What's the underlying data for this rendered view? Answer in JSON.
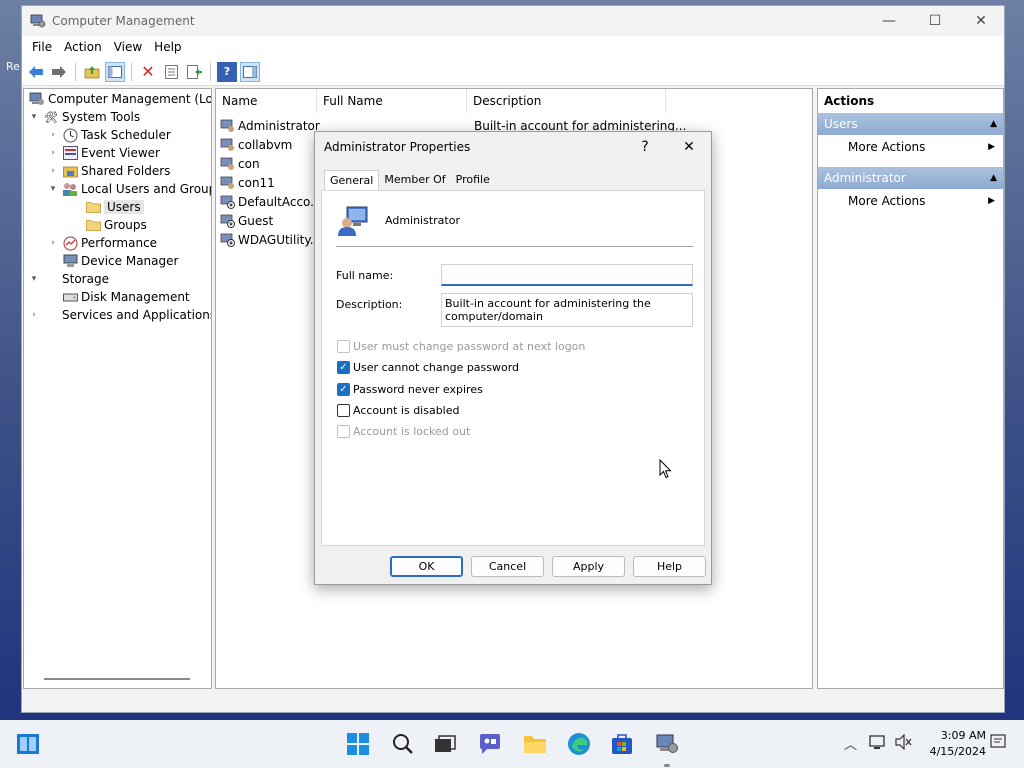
{
  "window": {
    "title": "Computer Management",
    "minimize_glyph": "—",
    "maximize_glyph": "☐",
    "close_glyph": "✕"
  },
  "menu": [
    "File",
    "Action",
    "View",
    "Help"
  ],
  "toolbar": {
    "icons": [
      "back-arrow-icon",
      "forward-arrow-icon",
      "up-folder-icon",
      "show-hide-tree-icon",
      "delete-icon",
      "properties-icon",
      "export-list-icon",
      "help-icon",
      "show-hide-action-pane-icon"
    ]
  },
  "tree": {
    "items": [
      {
        "label": "Computer Management (Local",
        "level": 0,
        "arrow": "",
        "icon": "computer-management-icon"
      },
      {
        "label": "System Tools",
        "level": 1,
        "arrow": "▾",
        "icon": "system-tools-icon"
      },
      {
        "label": "Task Scheduler",
        "level": 2,
        "arrow": "›",
        "icon": "task-scheduler-icon"
      },
      {
        "label": "Event Viewer",
        "level": 2,
        "arrow": "›",
        "icon": "event-viewer-icon"
      },
      {
        "label": "Shared Folders",
        "level": 2,
        "arrow": "›",
        "icon": "shared-folders-icon"
      },
      {
        "label": "Local Users and Groups",
        "level": 2,
        "arrow": "▾",
        "icon": "local-users-groups-icon"
      },
      {
        "label": "Users",
        "level": 3,
        "arrow": "",
        "icon": "folder-icon",
        "selected": true
      },
      {
        "label": "Groups",
        "level": 3,
        "arrow": "",
        "icon": "folder-icon"
      },
      {
        "label": "Performance",
        "level": 2,
        "arrow": "›",
        "icon": "performance-icon"
      },
      {
        "label": "Device Manager",
        "level": 2,
        "arrow": "",
        "icon": "device-manager-icon"
      },
      {
        "label": "Storage",
        "level": 1,
        "arrow": "▾",
        "icon": "storage-icon"
      },
      {
        "label": "Disk Management",
        "level": 2,
        "arrow": "",
        "icon": "disk-management-icon"
      },
      {
        "label": "Services and Applications",
        "level": 1,
        "arrow": "›",
        "icon": "services-applications-icon"
      }
    ]
  },
  "list": {
    "columns": [
      "Name",
      "Full Name",
      "Description"
    ],
    "rows": [
      {
        "name": "Administrator",
        "description": "Built-in account for administering..."
      },
      {
        "name": "collabvm",
        "description": ""
      },
      {
        "name": "con",
        "description": ""
      },
      {
        "name": "con11",
        "description": ""
      },
      {
        "name": "DefaultAcco...",
        "description": ""
      },
      {
        "name": "Guest",
        "description": ""
      },
      {
        "name": "WDAGUtility...",
        "description": ""
      }
    ]
  },
  "actions": {
    "title": "Actions",
    "sections": [
      {
        "header": "Users",
        "item": "More Actions"
      },
      {
        "header": "Administrator",
        "item": "More Actions"
      }
    ],
    "collapse_glyph": "▲",
    "submenu_glyph": "▶"
  },
  "dialog": {
    "title": "Administrator Properties",
    "help_glyph": "?",
    "close_glyph": "✕",
    "tabs": [
      "General",
      "Member Of",
      "Profile"
    ],
    "user_name": "Administrator",
    "full_name_label": "Full name:",
    "full_name_value": "",
    "description_label": "Description:",
    "description_value": "Built-in account for administering the computer/domain",
    "checkboxes": [
      {
        "label": "User must change password at next logon",
        "checked": false,
        "disabled": true
      },
      {
        "label": "User cannot change password",
        "checked": true,
        "disabled": false
      },
      {
        "label": "Password never expires",
        "checked": true,
        "disabled": false
      },
      {
        "label": "Account is disabled",
        "checked": false,
        "disabled": false
      },
      {
        "label": "Account is locked out",
        "checked": false,
        "disabled": true
      }
    ],
    "buttons": [
      "OK",
      "Cancel",
      "Apply",
      "Help"
    ]
  },
  "taskbar": {
    "time": "3:09 AM",
    "date": "4/15/2024",
    "apps": [
      "windows-start-icon",
      "search-icon",
      "task-view-icon",
      "chat-icon",
      "file-explorer-icon",
      "edge-icon",
      "store-icon",
      "computer-management-icon"
    ],
    "tray": [
      "show-hidden-icons-icon",
      "network-icon",
      "volume-muted-icon",
      "notifications-icon"
    ]
  },
  "colors": {
    "accent": "#1a6ec3",
    "actions_header": "#8eaad0",
    "selection": "#e5e5e5"
  }
}
